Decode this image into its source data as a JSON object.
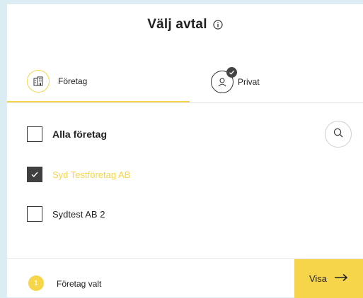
{
  "header": {
    "title": "Välj avtal",
    "info_icon": "info-icon"
  },
  "tabs": [
    {
      "label": "Företag",
      "icon": "building-icon",
      "active": true
    },
    {
      "label": "Privat",
      "icon": "person-icon",
      "badge_icon": "check-icon",
      "active": false
    }
  ],
  "list": {
    "items": [
      {
        "label": "Alla företag",
        "checked": false,
        "bold": true
      },
      {
        "label": "Syd Testföretag AB",
        "checked": true,
        "bold": false
      },
      {
        "label": "Sydtest AB 2",
        "checked": false,
        "bold": false
      }
    ],
    "search_icon": "search-icon"
  },
  "footer": {
    "count": "1",
    "count_label": "Företag valt",
    "button_label": "Visa",
    "button_icon": "arrow-right-icon"
  },
  "colors": {
    "accent": "#f7d54a",
    "text": "#222222",
    "checkbox_checked": "#3f3f3f",
    "background": "#dcecf3"
  }
}
